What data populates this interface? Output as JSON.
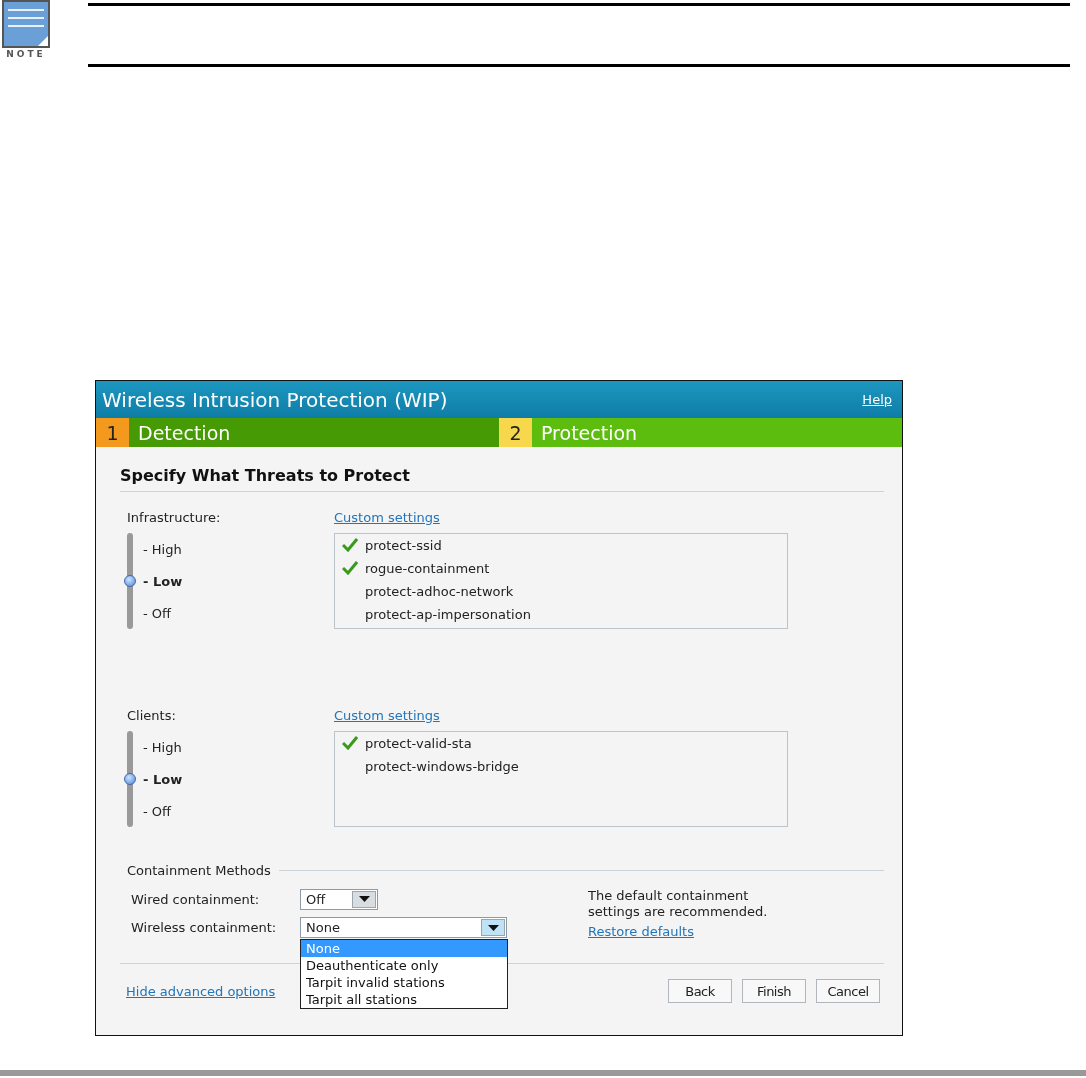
{
  "note": {
    "label": "NOTE"
  },
  "dialog": {
    "title": "Wireless Intrusion Protection (WIP)",
    "help": "Help",
    "steps": [
      {
        "number": "1",
        "label": "Detection",
        "selected": false
      },
      {
        "number": "2",
        "label": "Protection",
        "selected": true
      }
    ],
    "heading": "Specify What Threats to Protect",
    "sections": [
      {
        "label": "Infrastructure:",
        "link": "Custom settings",
        "levels": [
          {
            "label": "- High",
            "selected": false
          },
          {
            "label": "- Low",
            "selected": true
          },
          {
            "label": "- Off",
            "selected": false
          }
        ],
        "items": [
          {
            "label": "protect-ssid",
            "checked": true
          },
          {
            "label": "rogue-containment",
            "checked": true
          },
          {
            "label": "protect-adhoc-network",
            "checked": false
          },
          {
            "label": "protect-ap-impersonation",
            "checked": false
          }
        ]
      },
      {
        "label": "Clients:",
        "link": "Custom settings",
        "levels": [
          {
            "label": "- High",
            "selected": false
          },
          {
            "label": "- Low",
            "selected": true
          },
          {
            "label": "- Off",
            "selected": false
          }
        ],
        "items": [
          {
            "label": "protect-valid-sta",
            "checked": true
          },
          {
            "label": "protect-windows-bridge",
            "checked": false
          }
        ]
      }
    ],
    "containment": {
      "title": "Containment Methods",
      "wired": {
        "label": "Wired containment:",
        "value": "Off"
      },
      "wireless": {
        "label": "Wireless containment:",
        "value": "None",
        "expanded": true,
        "options": [
          {
            "label": "None",
            "selected": true
          },
          {
            "label": "Deauthenticate only",
            "selected": false
          },
          {
            "label": "Tarpit invalid stations",
            "selected": false
          },
          {
            "label": "Tarpit all stations",
            "selected": false
          }
        ]
      },
      "hint": "The default containment settings are recommended.",
      "restore": "Restore defaults"
    },
    "footer": {
      "link": "Hide advanced options",
      "buttons": [
        "Back",
        "Finish",
        "Cancel"
      ]
    }
  }
}
